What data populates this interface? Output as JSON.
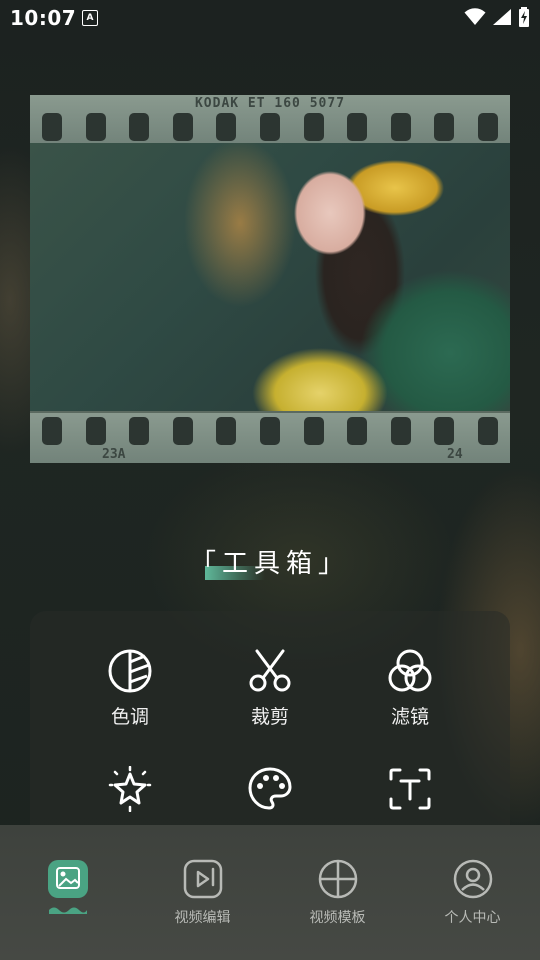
{
  "status_bar": {
    "time": "10:07",
    "notification_glyph": "A",
    "icons": [
      "wifi-icon",
      "signal-icon",
      "battery-charging-icon"
    ]
  },
  "film": {
    "code_text": "KODAK ET 160 5077",
    "frame_left": "23A",
    "frame_right": "24"
  },
  "toolbox": {
    "title": "「工具箱」"
  },
  "tools": [
    {
      "label": "色调",
      "icon": "color-tone-icon"
    },
    {
      "label": "裁剪",
      "icon": "scissors-icon"
    },
    {
      "label": "滤镜",
      "icon": "filter-circles-icon"
    },
    {
      "label": "",
      "icon": "sparkle-star-icon"
    },
    {
      "label": "",
      "icon": "palette-icon"
    },
    {
      "label": "",
      "icon": "text-frame-icon"
    }
  ],
  "bottom_nav": {
    "items": [
      {
        "label": "",
        "icon": "gallery-icon",
        "active": true
      },
      {
        "label": "视频编辑",
        "icon": "video-edit-icon",
        "active": false
      },
      {
        "label": "视频模板",
        "icon": "video-template-icon",
        "active": false
      },
      {
        "label": "个人中心",
        "icon": "profile-icon",
        "active": false
      }
    ]
  },
  "colors": {
    "accent": "#5fb89a",
    "active_tab_bg": "#4aa383"
  }
}
